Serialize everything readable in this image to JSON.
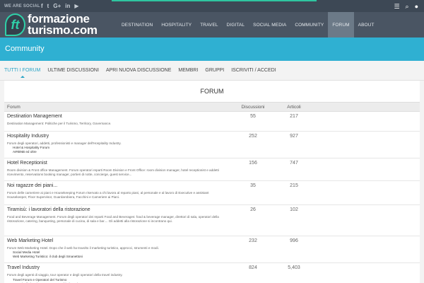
{
  "topbar": {
    "social_label": "WE ARE SOCIAL",
    "social_icons": [
      "facebook-icon",
      "twitter-icon",
      "google-plus-icon",
      "linkedin-icon",
      "youtube-icon"
    ],
    "social_glyphs": [
      "f",
      "t",
      "G+",
      "in",
      "▶"
    ]
  },
  "header": {
    "logo_mark": "ft",
    "logo_line1": "formazione",
    "logo_line2": "turismo.com",
    "nav": [
      "DESTINATION",
      "HOSPITALITY",
      "TRAVEL",
      "DIGITAL",
      "SOCIAL MEDIA",
      "COMMUNITY",
      "FORUM",
      "ABOUT"
    ],
    "active_nav": "FORUM"
  },
  "banner": {
    "title": "Community"
  },
  "subnav": {
    "tabs": [
      "TUTTI I FORUM",
      "ULTIME DISCUSSIONI",
      "APRI NUOVA DISCUSSIONE",
      "MEMBRI",
      "GRUPPI",
      "ISCRIVITI / ACCEDI"
    ],
    "active": "TUTTI I FORUM"
  },
  "forum": {
    "heading": "FORUM",
    "columns": {
      "forum": "Forum",
      "discussions": "Discussioni",
      "articles": "Articoli"
    },
    "rows": [
      {
        "name": "Destination Management",
        "desc": "Destination Management: Politiche per il Turismo, Territory, Governance.",
        "subs": [],
        "discussions": "55",
        "articles": "217"
      },
      {
        "name": "Hospitality Industry",
        "desc": "Forum degli operatori, addetti, professionisti e manager dell'Hospitality Industry.",
        "subs": [
          "Hotel & Hospitality Forum",
          "AIRBNB ed oltre"
        ],
        "discussions": "252",
        "articles": "927"
      },
      {
        "name": "Hotel Receptionist",
        "desc": "Room division & Front office Management. Forum operatori reparti Room Division e Front Office: room division manager, hotel receptionist e addetti ricevimento, reservations booking manager, portieri di notte, concierge, guest service...",
        "subs": [],
        "discussions": "156",
        "articles": "747"
      },
      {
        "name": "Noi ragazze dei piani...",
        "desc": "Forum delle cameriere ai piani e Housekeeping Forum riservato a chi lavora al reparto piani, al personale e al lavoro di Executive e assistant Housekeeper, Floor Supervisor, Guardarobiera, Facchini e Cameriere ai Piani.",
        "subs": [],
        "discussions": "35",
        "articles": "215"
      },
      {
        "name": "Tiramisù: i lavoratori della ristorazione",
        "desc": "Food and Beverage Management. Forum degli operatori dei reparti Food and Beverages: food & beverage manager, direttori di sala, operatori della ristorazione, catering, banqueting, personale di cucina, di sala e bar.... Gli addetti alla ristorazione si incontrano qui.",
        "subs": [],
        "discussions": "26",
        "articles": "102"
      },
      {
        "name": "Web Marketing Hotel",
        "desc": "Forum Web Marketing Hotel. Dopo che il web ha travolto il marketing turistico, approcci, strumenti e modi.",
        "subs": [
          "Social Media Hotel",
          "Web Marketing Turistico: il club degli Smanettoni"
        ],
        "discussions": "232",
        "articles": "996"
      },
      {
        "name": "Travel Industry",
        "desc": "Forum degli agenti di viaggio, tour operator e degli operatori della travel industry.",
        "subs": [
          "Travel Forum e Operatori del Turismo",
          "Agenzie di viaggi e Tour operator: chiedetemi tutto",
          "Oggi apro un'agenzia di viaggi"
        ],
        "discussions": "824",
        "articles": "5,403"
      }
    ]
  }
}
